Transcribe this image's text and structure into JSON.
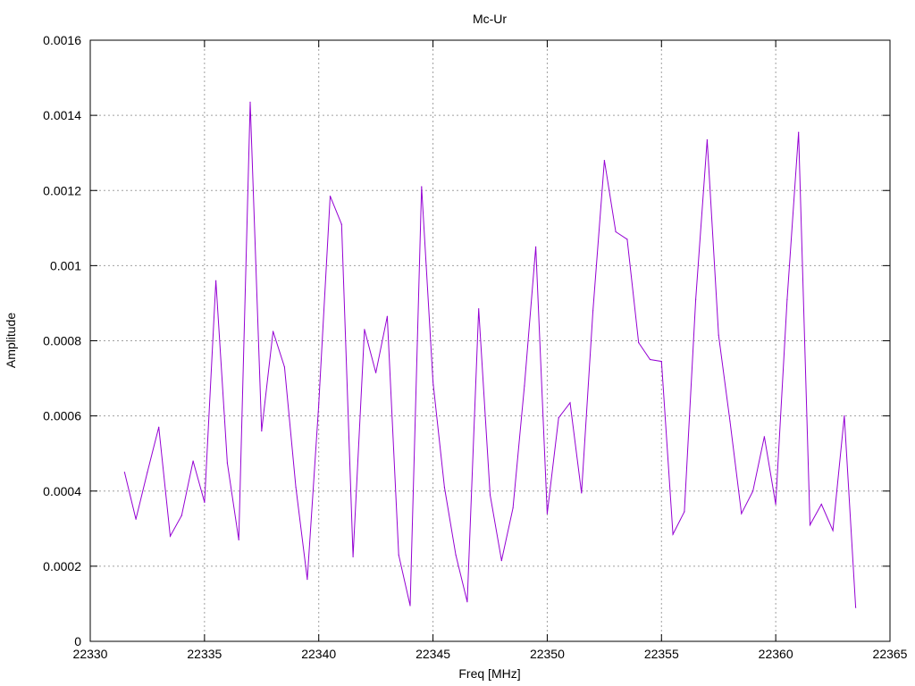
{
  "chart_data": {
    "type": "line",
    "title": "Mc-Ur",
    "xlabel": "Freq [MHz]",
    "ylabel": "Amplitude",
    "xlim": [
      22330,
      22365
    ],
    "ylim": [
      0,
      0.0016
    ],
    "x_ticks": [
      "22330",
      "22335",
      "22340",
      "22345",
      "22350",
      "22355",
      "22360",
      "22365"
    ],
    "y_ticks": [
      "0",
      "0.0002",
      "0.0004",
      "0.0006",
      "0.0008",
      "0.001",
      "0.0012",
      "0.0014",
      "0.0016"
    ],
    "grid": true,
    "series": [
      {
        "color": "#9400d3",
        "x": [
          22331.5,
          22332.0,
          22332.5,
          22333.0,
          22333.5,
          22334.0,
          22334.5,
          22335.0,
          22335.5,
          22336.0,
          22336.5,
          22337.0,
          22337.5,
          22338.0,
          22338.5,
          22339.0,
          22339.5,
          22340.0,
          22340.5,
          22341.0,
          22341.5,
          22342.0,
          22342.5,
          22343.0,
          22343.5,
          22344.0,
          22344.5,
          22345.0,
          22345.5,
          22346.0,
          22346.5,
          22347.0,
          22347.5,
          22348.0,
          22348.5,
          22349.0,
          22349.5,
          22350.0,
          22350.5,
          22351.0,
          22351.5,
          22352.0,
          22352.5,
          22353.0,
          22353.5,
          22354.0,
          22354.5,
          22355.0,
          22355.5,
          22356.0,
          22356.5,
          22357.0,
          22357.5,
          22358.0,
          22358.5,
          22359.0,
          22359.5,
          22360.0,
          22360.5,
          22361.0,
          22361.5,
          22362.0,
          22362.5,
          22363.0,
          22363.5
        ],
        "y": [
          0.00045,
          0.000325,
          0.00045,
          0.00057,
          0.00028,
          0.000335,
          0.00048,
          0.00037,
          0.00096,
          0.000475,
          0.00027,
          0.001435,
          0.00056,
          0.000825,
          0.00073,
          0.00041,
          0.000165,
          0.00063,
          0.001185,
          0.00111,
          0.000225,
          0.00083,
          0.000715,
          0.000865,
          0.00023,
          9.5e-05,
          0.00121,
          0.00069,
          0.00041,
          0.00023,
          0.000105,
          0.000885,
          0.00039,
          0.000215,
          0.000355,
          0.00068,
          0.00105,
          0.00034,
          0.000595,
          0.000635,
          0.000395,
          0.00088,
          0.00128,
          0.00109,
          0.00107,
          0.000795,
          0.00075,
          0.000745,
          0.000285,
          0.000345,
          0.00091,
          0.001335,
          0.000815,
          0.000585,
          0.00034,
          0.0004,
          0.000545,
          0.000365,
          0.00091,
          0.001355,
          0.00031,
          0.000365,
          0.000295,
          0.0006,
          9e-05
        ]
      }
    ]
  }
}
